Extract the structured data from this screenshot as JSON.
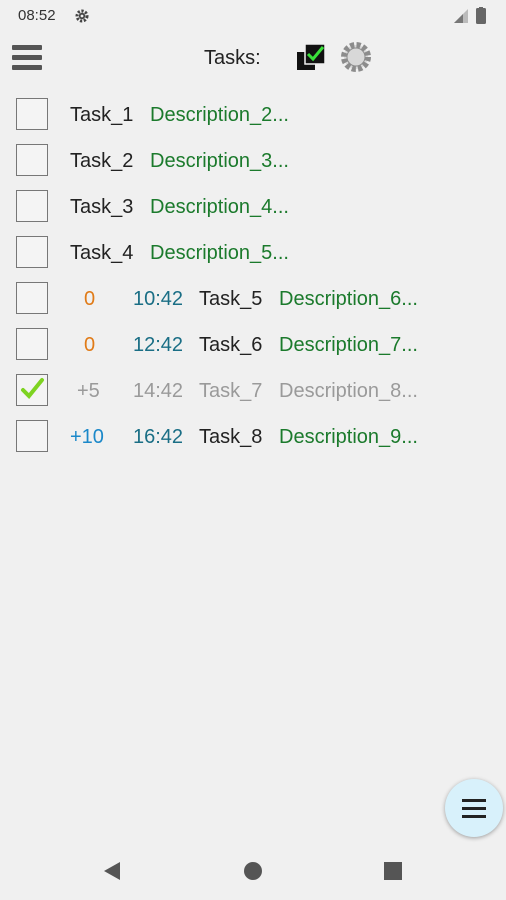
{
  "status_bar": {
    "time": "08:52"
  },
  "app_bar": {
    "title": "Tasks:"
  },
  "tasks": [
    {
      "name": "Task_1",
      "description": "Description_2...",
      "checked": false
    },
    {
      "name": "Task_2",
      "description": "Description_3...",
      "checked": false
    },
    {
      "name": "Task_3",
      "description": "Description_4...",
      "checked": false
    },
    {
      "name": "Task_4",
      "description": "Description_5...",
      "checked": false
    },
    {
      "offset": "0",
      "time": "10:42",
      "name": "Task_5",
      "description": "Description_6...",
      "checked": false
    },
    {
      "offset": "0",
      "time": "12:42",
      "name": "Task_6",
      "description": "Description_7...",
      "checked": false
    },
    {
      "offset": "+5",
      "time": "14:42",
      "name": "Task_7",
      "description": "Description_8...",
      "checked": true
    },
    {
      "offset": "+10",
      "time": "16:42",
      "name": "Task_8",
      "description": "Description_9...",
      "checked": false
    }
  ],
  "colors": {
    "description": "#1b7a2c",
    "time": "#1a6e85",
    "offset_zero": "#e07b18",
    "offset_positive": "#1b88c9",
    "completed": "#9a9a9a",
    "check": "#7ed321",
    "fab_background": "#d8f1fb"
  },
  "icons": {
    "status_settings": "gear-icon",
    "menu": "hamburger-menu-icon",
    "check_all": "stacked-checkbox-icon",
    "settings": "gear-outline-icon",
    "fab": "list-menu-icon",
    "nav_back": "triangle-back-icon",
    "nav_home": "circle-home-icon",
    "nav_recents": "square-recents-icon"
  }
}
